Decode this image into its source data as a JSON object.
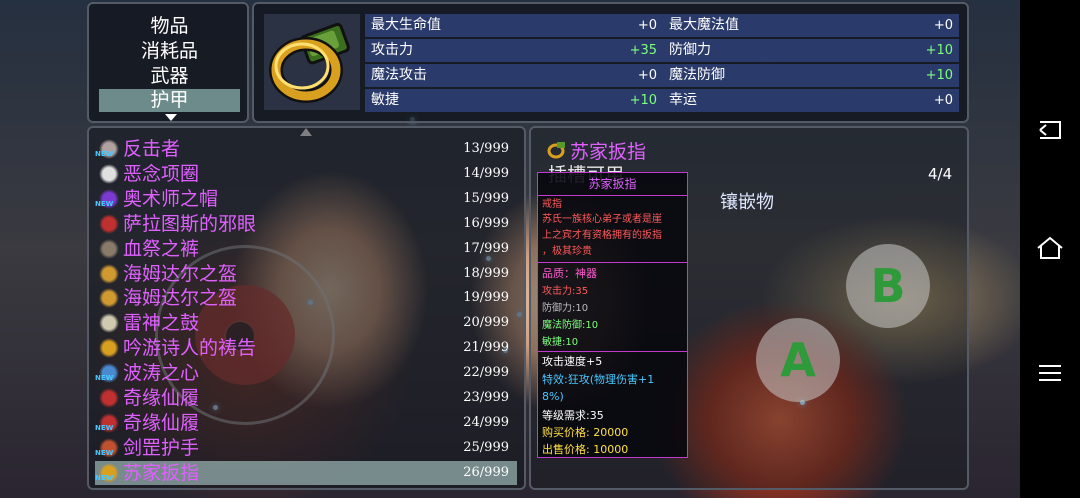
{
  "categories": [
    {
      "label": "物品",
      "selected": false
    },
    {
      "label": "消耗品",
      "selected": false
    },
    {
      "label": "武器",
      "selected": false
    },
    {
      "label": "护甲",
      "selected": true
    }
  ],
  "stats": [
    {
      "name": "最大生命值",
      "value": "+0",
      "up": false
    },
    {
      "name": "最大魔法值",
      "value": "+0",
      "up": false
    },
    {
      "name": "攻击力",
      "value": "+35",
      "up": true
    },
    {
      "name": "防御力",
      "value": "+10",
      "up": true
    },
    {
      "name": "魔法攻击",
      "value": "+0",
      "up": false
    },
    {
      "name": "魔法防御",
      "value": "+10",
      "up": true
    },
    {
      "name": "敏捷",
      "value": "+10",
      "up": true
    },
    {
      "name": "幸运",
      "value": "+0",
      "up": false
    }
  ],
  "items": [
    {
      "name": "反击者",
      "qty": "13/999",
      "new": true,
      "icon": "armor-icon",
      "selected": false
    },
    {
      "name": "恶念项圈",
      "qty": "14/999",
      "new": false,
      "icon": "collar-icon",
      "selected": false
    },
    {
      "name": "奥术师之帽",
      "qty": "15/999",
      "new": true,
      "icon": "hat-icon",
      "selected": false
    },
    {
      "name": "萨拉图斯的邪眼",
      "qty": "16/999",
      "new": false,
      "icon": "eye-icon",
      "selected": false
    },
    {
      "name": "血祭之裤",
      "qty": "17/999",
      "new": false,
      "icon": "pants-icon",
      "selected": false
    },
    {
      "name": "海姆达尔之盔",
      "qty": "18/999",
      "new": false,
      "icon": "helmet-icon",
      "selected": false
    },
    {
      "name": "海姆达尔之盔",
      "qty": "19/999",
      "new": false,
      "icon": "helmet-icon",
      "selected": false
    },
    {
      "name": "雷神之鼓",
      "qty": "20/999",
      "new": false,
      "icon": "drum-icon",
      "selected": false
    },
    {
      "name": "吟游诗人的祷告",
      "qty": "21/999",
      "new": false,
      "icon": "ring-icon",
      "selected": false
    },
    {
      "name": "波涛之心",
      "qty": "22/999",
      "new": true,
      "icon": "heart-icon",
      "selected": false
    },
    {
      "name": "奇缘仙履",
      "qty": "23/999",
      "new": false,
      "icon": "shoe-icon",
      "selected": false
    },
    {
      "name": "奇缘仙履",
      "qty": "24/999",
      "new": true,
      "icon": "shoe-icon",
      "selected": false
    },
    {
      "name": "剑罡护手",
      "qty": "25/999",
      "new": true,
      "icon": "glove-icon",
      "selected": false
    },
    {
      "name": "苏家扳指",
      "qty": "26/999",
      "new": true,
      "icon": "ring-icon",
      "selected": true
    }
  ],
  "new_badge": "NEW",
  "detail": {
    "title": "苏家扳指",
    "inlay_header": "插槽可用",
    "slots": "4/4",
    "inlay_label": "镶嵌物"
  },
  "tooltip": {
    "name": "苏家扳指",
    "type": "戒指",
    "desc1": "苏氏一族核心弟子或者是崖",
    "desc2": "上之宾才有资格拥有的扳指",
    "desc3": "，极其珍贵",
    "quality": "品质：神器",
    "atk": "攻击力:35",
    "def": "防御力:10",
    "mdef": "魔法防御:10",
    "agi": "敏捷:10",
    "speed": "攻击速度+5",
    "effect1": "特效:狂攻(物理伤害+1",
    "effect2": "8%)",
    "level": "等级需求:35",
    "buy": "购买价格:  20000",
    "sell": "出售价格:  10000"
  },
  "buttons": {
    "a": "A",
    "b": "B"
  },
  "colors": {
    "item_name": "#e060ff",
    "stat_up": "#7dff7d",
    "stat_bg": "#2a3a6a",
    "selection": "#6d8b8b"
  }
}
